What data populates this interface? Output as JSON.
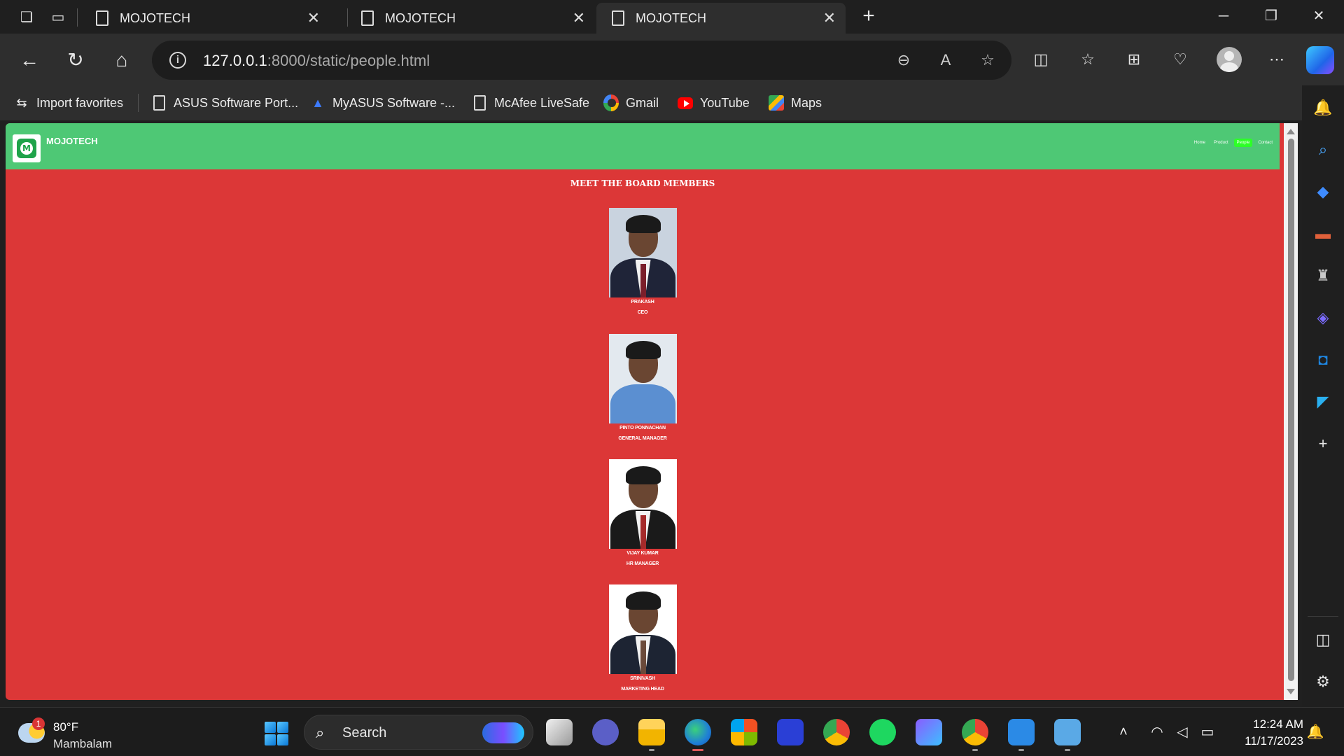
{
  "browser": {
    "tabs": [
      {
        "title": "MOJOTECH"
      },
      {
        "title": "MOJOTECH"
      },
      {
        "title": "MOJOTECH"
      }
    ],
    "url_host": "127.0.0.1",
    "url_path": ":8000/static/people.html",
    "favorites": [
      {
        "label": "Import favorites",
        "icon": "import-icon"
      },
      {
        "label": "ASUS Software Port...",
        "icon": "page-icon"
      },
      {
        "label": "MyASUS Software -...",
        "icon": "myasus-icon"
      },
      {
        "label": "McAfee LiveSafe",
        "icon": "page-icon"
      },
      {
        "label": "Gmail",
        "icon": "google-icon"
      },
      {
        "label": "YouTube",
        "icon": "youtube-icon"
      },
      {
        "label": "Maps",
        "icon": "maps-icon"
      }
    ]
  },
  "site": {
    "brand": "MOJOTECH",
    "nav": [
      {
        "label": "Home"
      },
      {
        "label": "Product"
      },
      {
        "label": "People",
        "current": true
      },
      {
        "label": "Contact"
      }
    ],
    "section_title": "MEET THE BOARD MEMBERS",
    "members": [
      {
        "name": "PRAKASH",
        "role": "CEO",
        "suit_color": "#1f2438",
        "bg": "#c9d3df",
        "shirt": "#e8e8e8"
      },
      {
        "name": "PINTO PONNACHAN",
        "role": "GENERAL MANAGER",
        "suit_color": "#5b8fd1",
        "bg": "#e3e9ef",
        "shirt": "#5b8fd1"
      },
      {
        "name": "VIJAY KUMAR",
        "role": "HR MANAGER",
        "suit_color": "#1a1a1a",
        "bg": "#ffffff",
        "shirt": "#ffffff"
      },
      {
        "name": "SRINIVASH",
        "role": "MARKETING HEAD",
        "suit_color": "#1d2433",
        "bg": "#ffffff",
        "shirt": "#f0f0f0"
      }
    ]
  },
  "colors": {
    "header_green": "#4ec875",
    "page_red": "#dc3737",
    "nav_active": "#2dff27"
  },
  "taskbar": {
    "weather_temp": "80°F",
    "weather_location": "Mambalam",
    "weather_badge": "1",
    "search_label": "Search",
    "time": "12:24 AM",
    "date": "11/17/2023"
  }
}
